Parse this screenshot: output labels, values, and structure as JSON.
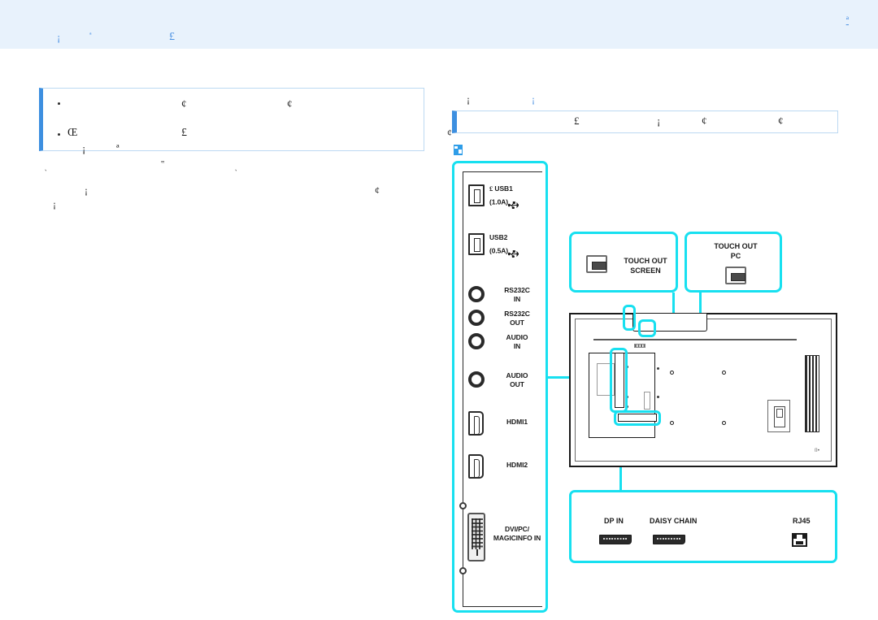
{
  "header": {
    "band_color": "#e8f2fc",
    "accent_color": "#4a90e2",
    "glyph_1": "¡",
    "glyph_2": "ª",
    "glyph_3": "£",
    "page_marker": "ª"
  },
  "left_column": {
    "note_box": {
      "accent_color": "#3d8fe0",
      "border_color": "#bcd9f2",
      "line1_glyph_a": "¢",
      "line1_glyph_b": "¢",
      "line2_glyph_a": "Œ",
      "line2_glyph_b": "£",
      "line3_glyph_a": "¡",
      "line3_glyph_b": "ª"
    },
    "body": {
      "g1": "‟",
      "g2": "‵",
      "g3": "‵",
      "g4": "¡",
      "g5": "¢",
      "g6": "¡"
    }
  },
  "right_column": {
    "sublabel_dark": "¡",
    "sublabel_blue": "¡",
    "table_bar": {
      "accent_color": "#3d8fe0",
      "border_color": "#bcd9f2",
      "g1": "£",
      "g2": "¡",
      "g3": "¢",
      "g4": "¢",
      "outside_glyph": "¢"
    },
    "note_icon_name": "note-icon"
  },
  "diagram": {
    "highlight_color": "#17e0f0",
    "port_panel": {
      "ports": [
        {
          "id": "usb1",
          "label": "USB1\n(1.0A)",
          "prefix_glyph": "£",
          "connector": "usb-a",
          "has_usb_symbol": true
        },
        {
          "id": "usb2",
          "label": "USB2\n(0.5A)",
          "prefix_glyph": "",
          "connector": "usb-a",
          "has_usb_symbol": true
        },
        {
          "id": "rs232in",
          "label": "RS232C\nIN",
          "prefix_glyph": "",
          "connector": "jack-round",
          "has_usb_symbol": false
        },
        {
          "id": "rs232out",
          "label": "RS232C\nOUT",
          "prefix_glyph": "",
          "connector": "jack-round",
          "has_usb_symbol": false
        },
        {
          "id": "audioin",
          "label": "AUDIO\nIN",
          "prefix_glyph": "",
          "connector": "jack-round",
          "has_usb_symbol": false
        },
        {
          "id": "audioout",
          "label": "AUDIO\nOUT",
          "prefix_glyph": "",
          "connector": "jack-round",
          "has_usb_symbol": false
        },
        {
          "id": "hdmi1",
          "label": "HDMI1",
          "prefix_glyph": "",
          "connector": "hdmi",
          "has_usb_symbol": false
        },
        {
          "id": "hdmi2",
          "label": "HDMI2",
          "prefix_glyph": "",
          "connector": "hdmi",
          "has_usb_symbol": false
        },
        {
          "id": "dvi",
          "label": "DVI/PC/\nMAGICINFO IN",
          "prefix_glyph": "",
          "connector": "dvi",
          "has_usb_symbol": false
        }
      ]
    },
    "touch_boxes": [
      {
        "id": "touch-out-screen",
        "label": "TOUCH OUT\nSCREEN",
        "connector": "usb-b",
        "layout": "icon-left"
      },
      {
        "id": "touch-out-pc",
        "label": "TOUCH OUT\nPC",
        "connector": "usb-b",
        "layout": "icon-below"
      }
    ],
    "bottom_panel": {
      "items": [
        {
          "id": "dp-in",
          "label": "DP IN",
          "connector": "displayport"
        },
        {
          "id": "daisy-chain",
          "label": "DAISY CHAIN",
          "connector": "displayport"
        },
        {
          "id": "rj45",
          "label": "RJ45",
          "connector": "rj45"
        }
      ]
    },
    "monitor": {
      "name": "display-rear-view",
      "logo_glyph": "⌷•"
    }
  }
}
